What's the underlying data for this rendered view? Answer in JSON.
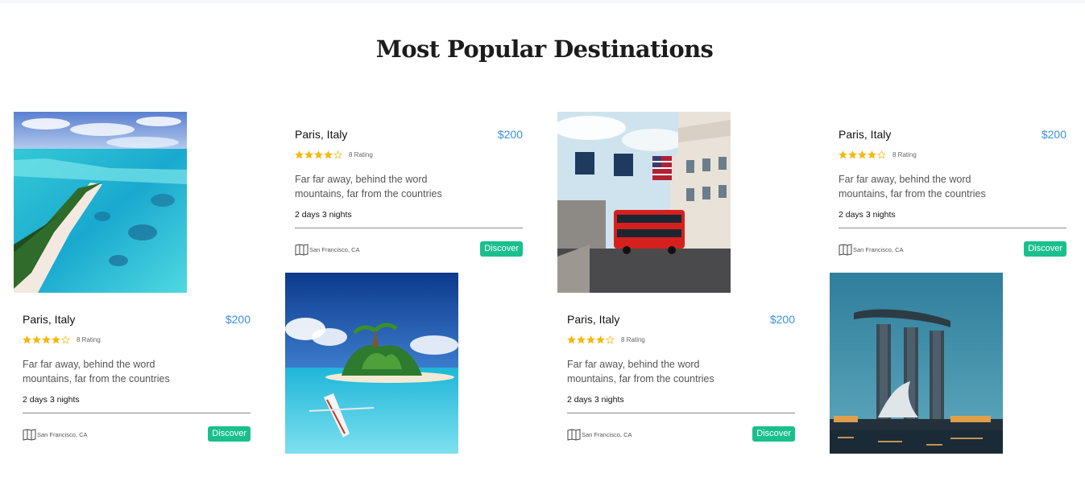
{
  "section": {
    "title": "Most Popular Destinations"
  },
  "colors": {
    "accent": "#19c08e",
    "price": "#3d8fe0",
    "star": "#f5b90f"
  },
  "photos": [
    {
      "name": "aerial-beach-lagoon-photo"
    },
    {
      "name": "tropical-island-canoe-photo"
    },
    {
      "name": "london-street-bus-photo"
    },
    {
      "name": "marina-bay-sands-photo"
    }
  ],
  "cards": [
    {
      "title": "Paris, Italy",
      "price": "$200",
      "stars_filled": 4,
      "stars_total": 5,
      "rating": "8 Rating",
      "description": "Far far away, behind the word mountains, far from the countries",
      "duration": "2 days 3 nights",
      "location": "San Francisco, CA",
      "location_icon": "map-icon",
      "button": "Discover"
    },
    {
      "title": "Paris, Italy",
      "price": "$200",
      "stars_filled": 4,
      "stars_total": 5,
      "rating": "8 Rating",
      "description": "Far far away, behind the word mountains, far from the countries",
      "duration": "2 days 3 nights",
      "location": "San Francisco, CA",
      "location_icon": "map-icon",
      "button": "Discover"
    },
    {
      "title": "Paris, Italy",
      "price": "$200",
      "stars_filled": 4,
      "stars_total": 5,
      "rating": "8 Rating",
      "description": "Far far away, behind the word mountains, far from the countries",
      "duration": "2 days 3 nights",
      "location": "San Francisco, CA",
      "location_icon": "map-icon",
      "button": "Discover"
    },
    {
      "title": "Paris, Italy",
      "price": "$200",
      "stars_filled": 4,
      "stars_total": 5,
      "rating": "8 Rating",
      "description": "Far far away, behind the word mountains, far from the countries",
      "duration": "2 days 3 nights",
      "location": "San Francisco, CA",
      "location_icon": "map-icon",
      "button": "Discover"
    }
  ]
}
